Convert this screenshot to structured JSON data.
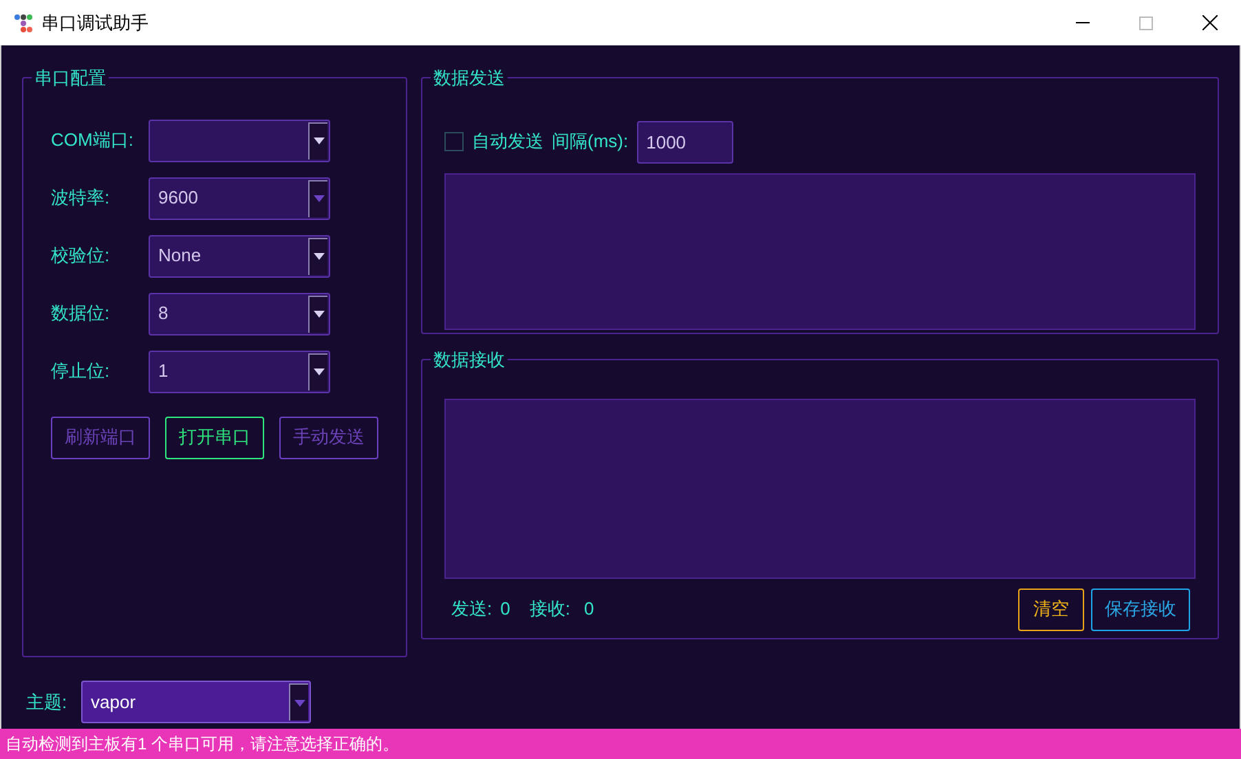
{
  "window": {
    "title": "串口调试助手"
  },
  "config": {
    "title": "串口配置",
    "fields": [
      {
        "label": "COM端口:"
      },
      {
        "label": "波特率:",
        "value": "9600"
      },
      {
        "label": "校验位:",
        "value": "None"
      },
      {
        "label": "数据位:",
        "value": "8"
      },
      {
        "label": "停止位:",
        "value": "1"
      }
    ],
    "buttons": [
      {
        "label": "刷新端口",
        "disabled": true
      },
      {
        "label": "打开串口",
        "disabled": false
      },
      {
        "label": "手动发送",
        "disabled": true
      }
    ]
  },
  "send": {
    "title": "数据发送",
    "auto_send": {
      "label": "自动发送",
      "checked": false
    },
    "interval_label": "间隔(ms):",
    "interval": "1000"
  },
  "receive": {
    "title": "数据接收",
    "sent_label": "发送:",
    "sent": "0",
    "received_label": "接收:",
    "received": "0",
    "buttons": [
      {
        "label": "清空",
        "kind": "clear"
      },
      {
        "label": "保存接收",
        "kind": "save"
      }
    ]
  },
  "theme": {
    "label": "主题:",
    "value": "vapor"
  },
  "status_bar": "自动检测到主板有1 个串口可用，请注意选择正确的。"
}
